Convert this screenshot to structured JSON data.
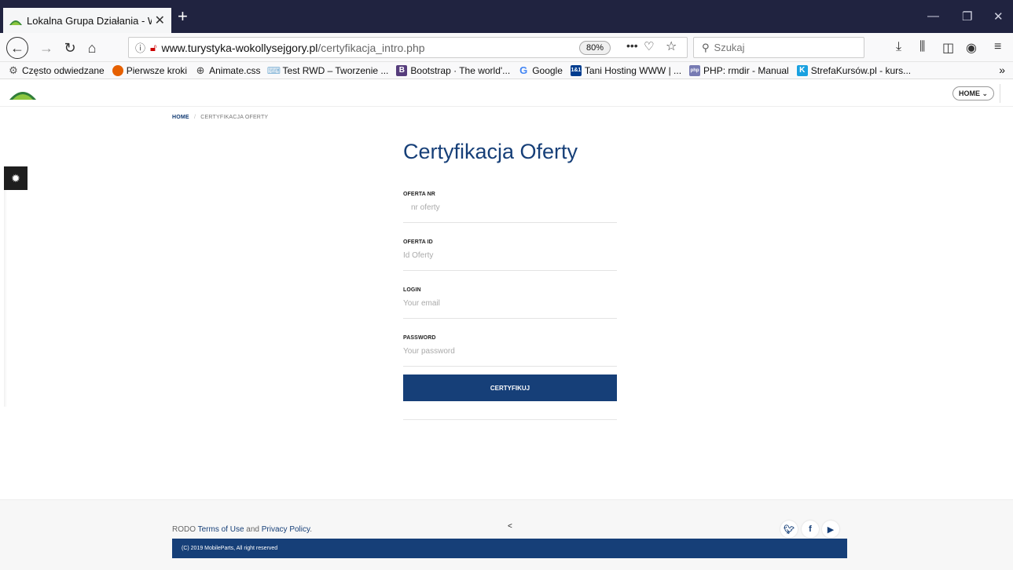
{
  "browser": {
    "tab": {
      "title": "Lokalna Grupa Działania - Wok",
      "close": "✕"
    },
    "new_tab": "+",
    "window_controls": {
      "minimize": "—",
      "restore": "❐",
      "close": "✕"
    },
    "url": {
      "host": "www.turystyka-wokollysejgory.pl",
      "path": "/certyfikacja_intro.php",
      "zoom": "80%"
    },
    "search_placeholder": "Szukaj",
    "bookmarks": [
      {
        "label": "Często odwiedzane",
        "icon": "gear-icon",
        "color": "#555555"
      },
      {
        "label": "Pierwsze kroki",
        "icon": "firefox-icon",
        "color": "#e66000"
      },
      {
        "label": "Animate.css",
        "icon": "globe-icon",
        "color": "#555555"
      },
      {
        "label": "Test RWD – Tworzenie ...",
        "icon": "rwd-icon",
        "color": "#7fb2d6"
      },
      {
        "label": "Bootstrap · The world'...",
        "icon": "bootstrap-icon",
        "color": "#563d7c"
      },
      {
        "label": "Google",
        "icon": "google-icon",
        "color": "#4285f4"
      },
      {
        "label": "Tani Hosting WWW | ...",
        "icon": "hosting-icon",
        "color": "#003d8f"
      },
      {
        "label": "PHP: rmdir - Manual",
        "icon": "php-icon",
        "color": "#777bb3"
      },
      {
        "label": "StrefaKursów.pl - kurs...",
        "icon": "strefa-icon",
        "color": "#1aa1e0"
      }
    ]
  },
  "site": {
    "home_menu": "HOME",
    "breadcrumb": {
      "home": "HOME",
      "separator": "/",
      "current": "CERTYFIKACJA OFERTY"
    },
    "title": "Certyfikacja Oferty",
    "form": {
      "offer_nr": {
        "label": "OFERTA NR",
        "placeholder": "nr oferty"
      },
      "offer_id": {
        "label": "OFERTA ID",
        "placeholder": "Id Oferty"
      },
      "login": {
        "label": "LOGIN",
        "placeholder": "Your email"
      },
      "password": {
        "label": "PASSWORD",
        "placeholder": "Your password"
      },
      "submit": "CERTYFIKUJ"
    },
    "footer": {
      "rodo": "RODO",
      "terms": "Terms of Use",
      "and": "and",
      "privacy": "Privacy Policy",
      "period": ".",
      "scroll_top": "˂",
      "copyright": "(C) 2019 MobileParts, All right reserved"
    },
    "colors": {
      "primary": "#163f78",
      "browser_dark": "#202340"
    }
  }
}
